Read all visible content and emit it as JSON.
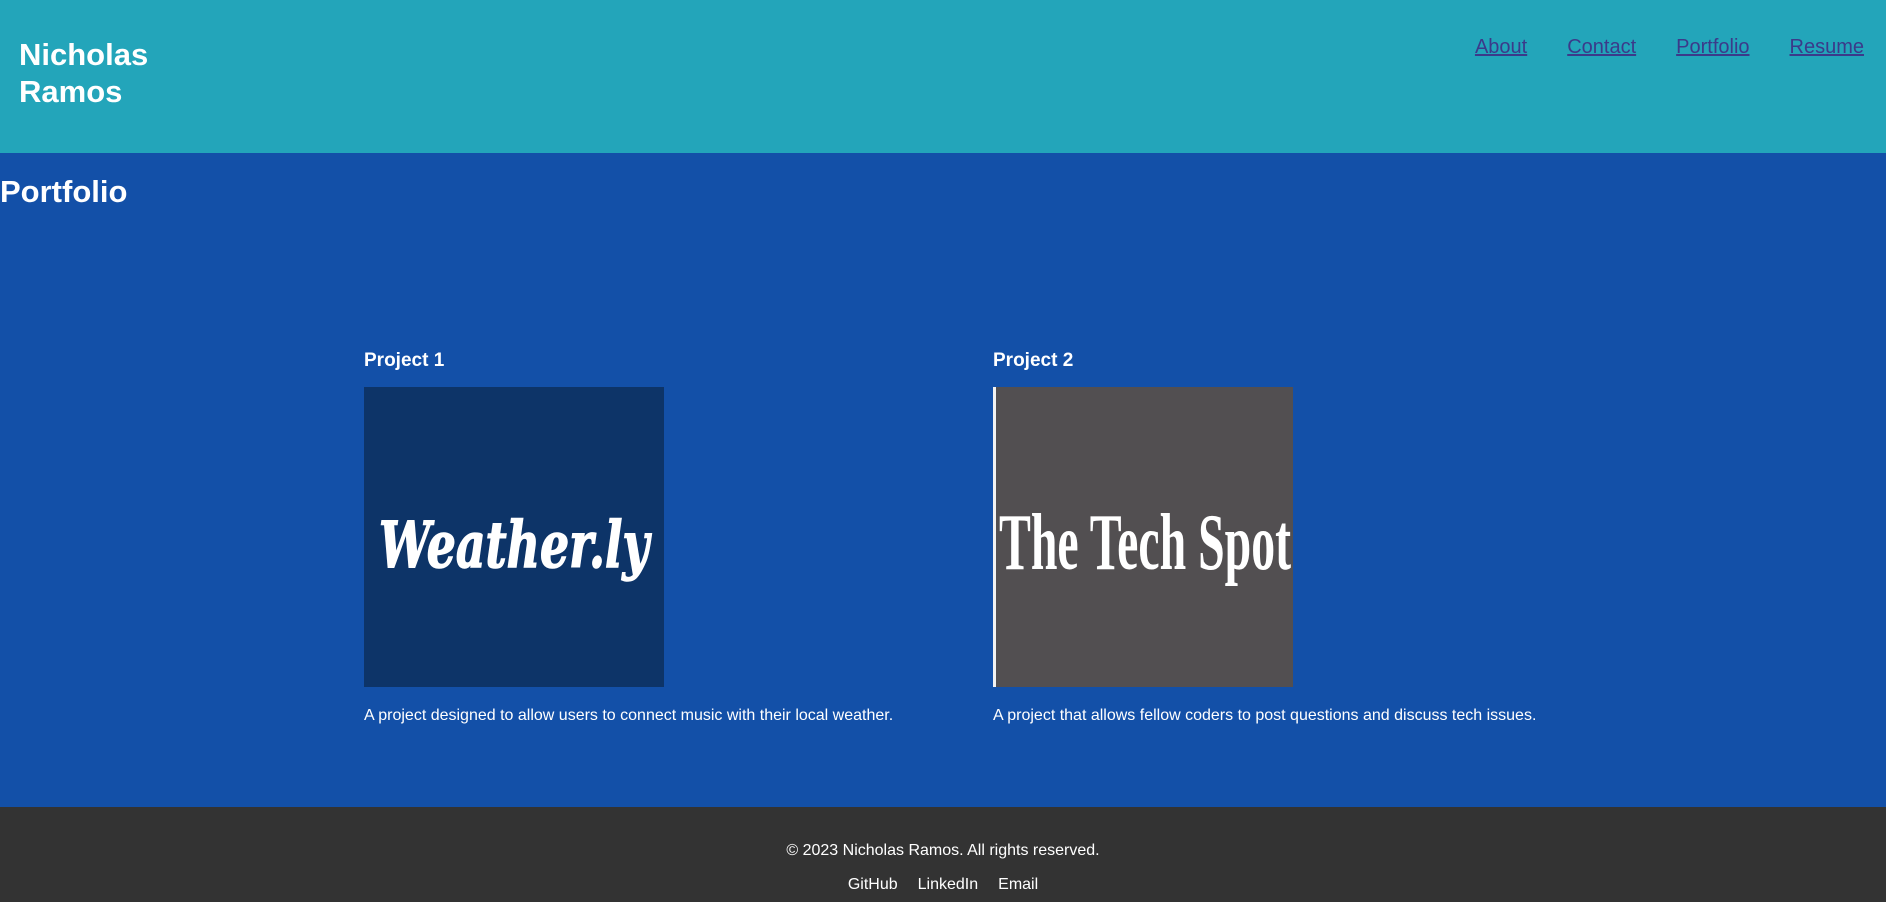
{
  "header": {
    "site_name": "Nicholas Ramos",
    "nav": [
      "About",
      "Contact",
      "Portfolio",
      "Resume"
    ]
  },
  "main": {
    "section_title": "Portfolio",
    "projects": [
      {
        "title": "Project 1",
        "image_text": "Weather.ly",
        "description": "A project designed to allow users to connect music with their local weather."
      },
      {
        "title": "Project 2",
        "image_text": "The Tech Spot",
        "description": "A project that allows fellow coders to post questions and discuss tech issues."
      }
    ]
  },
  "footer": {
    "copyright": "© 2023 Nicholas Ramos. All rights reserved.",
    "links": [
      "GitHub",
      "LinkedIn",
      "Email"
    ]
  },
  "colors": {
    "header_bg": "#23a5ba",
    "main_bg": "#1350a8",
    "footer_bg": "#333333",
    "nav_link": "#3b3a8a",
    "project1_image_bg": "#0d3468",
    "project2_image_bg": "#524f51"
  }
}
